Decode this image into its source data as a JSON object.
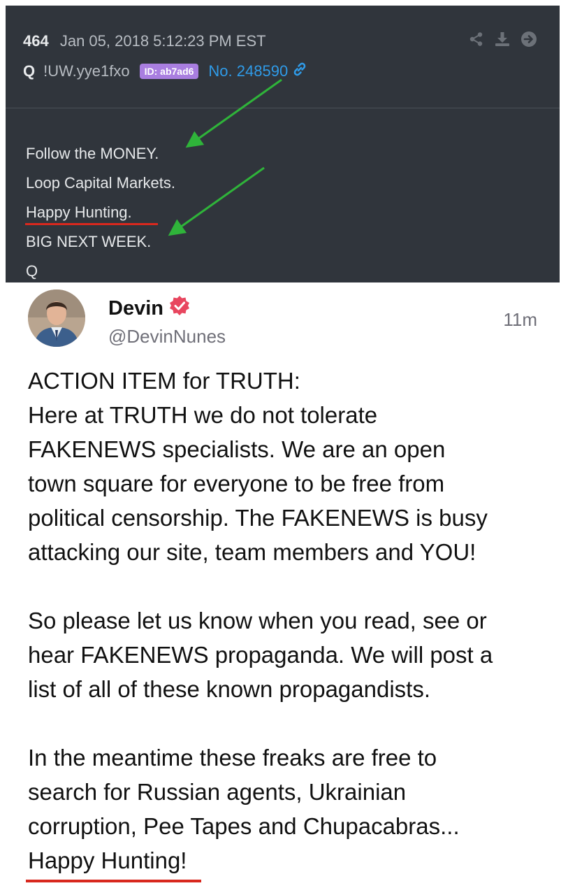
{
  "qpost": {
    "post_number": "464",
    "datetime": "Jan 05, 2018 5:12:23 PM EST",
    "author": "Q",
    "tripcode": "!UW.yye1fxo",
    "id_badge": "ID: ab7ad6",
    "post_no": "No. 248590",
    "icons": [
      "share-icon",
      "download-icon",
      "arrow-right-icon"
    ],
    "lines": [
      "Follow the MONEY.",
      "Loop Capital Markets.",
      "Happy Hunting.",
      "BIG NEXT WEEK.",
      "Q"
    ],
    "colors": {
      "background": "#30353c",
      "id_badge": "#a97ee0",
      "link": "#2f9be8",
      "arrow": "#2fb43a",
      "underline": "#d8281e"
    }
  },
  "truth_post": {
    "display_name": "Devin",
    "handle": "@DevinNunes",
    "timestamp": "11m",
    "verified_icon": "verified-badge-icon",
    "lines": [
      "ACTION ITEM for TRUTH:",
      "Here at TRUTH we do not tolerate",
      "FAKENEWS specialists. We are an open",
      "town square for everyone to be free from",
      "political censorship. The FAKENEWS is busy",
      "attacking our site, team members and YOU!",
      "",
      "So please let us know when you read, see or",
      "hear FAKENEWS propaganda. We will post a",
      "list of all of these known propagandists.",
      "",
      "In the meantime these freaks are free to",
      "search for Russian agents, Ukrainian",
      "corruption, Pee Tapes and Chupacabras...",
      "Happy Hunting!"
    ],
    "colors": {
      "verified": "#e8465f",
      "underline": "#d8281e"
    }
  }
}
